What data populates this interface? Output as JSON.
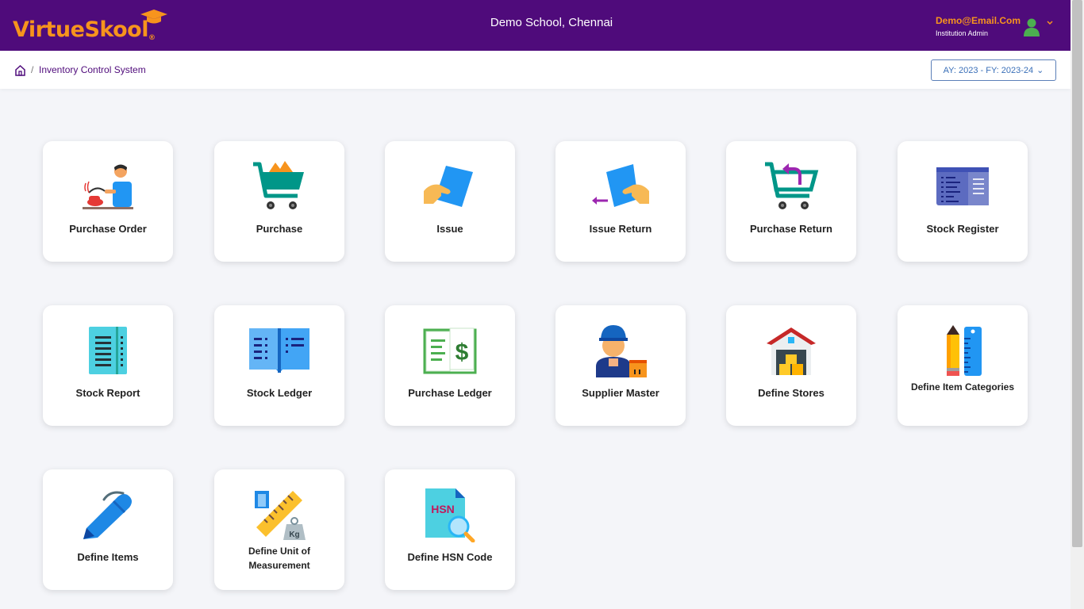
{
  "header": {
    "logo_part1": "Virtue",
    "logo_part2": "Skool",
    "logo_mark": "®",
    "school": "Demo School, Chennai",
    "user_email": "Demo@Email.Com",
    "user_role": "Institution Admin"
  },
  "breadcrumb": {
    "separator": "/",
    "current": "Inventory Control System"
  },
  "year_selector": {
    "label": "AY: 2023 - FY: 2023-24",
    "caret": "⌄"
  },
  "tiles": [
    {
      "label": "Purchase Order",
      "icon": "purchase-order-icon"
    },
    {
      "label": "Purchase",
      "icon": "shopping-cart-icon"
    },
    {
      "label": "Issue",
      "icon": "hand-give-icon"
    },
    {
      "label": "Issue Return",
      "icon": "hand-return-icon"
    },
    {
      "label": "Purchase Return",
      "icon": "cart-return-icon"
    },
    {
      "label": "Stock Register",
      "icon": "register-icon"
    },
    {
      "label": "Stock Report",
      "icon": "report-icon"
    },
    {
      "label": "Stock Ledger",
      "icon": "open-book-icon"
    },
    {
      "label": "Purchase Ledger",
      "icon": "dollar-ledger-icon"
    },
    {
      "label": "Supplier Master",
      "icon": "delivery-man-icon"
    },
    {
      "label": "Define Stores",
      "icon": "warehouse-icon"
    },
    {
      "label": "Define Item Categories",
      "icon": "pencil-ruler-icon"
    },
    {
      "label": "Define Items",
      "icon": "pen-icon"
    },
    {
      "label": "Define Unit of Measurement",
      "icon": "measurement-icon"
    },
    {
      "label": "Define HSN Code",
      "icon": "hsn-search-icon"
    }
  ],
  "hsn_text": "HSN",
  "kg_text": "Kg"
}
